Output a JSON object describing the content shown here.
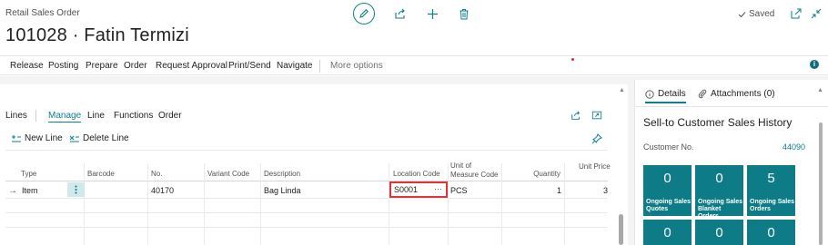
{
  "header": {
    "breadcrumb": "Retail Sales Order",
    "title": "101028 · Fatin Termizi",
    "saved_label": "Saved"
  },
  "actions": [
    "Release",
    "Posting",
    "Prepare",
    "Order",
    "Request Approval",
    "Print/Send",
    "Navigate"
  ],
  "more_options": "More options",
  "lines": {
    "title": "Lines",
    "tabs": [
      "Manage",
      "Line",
      "Functions",
      "Order"
    ],
    "new_line": "New Line",
    "delete_line": "Delete Line",
    "columns": {
      "type": "Type",
      "barcode": "Barcode",
      "no": "No.",
      "variant_code": "Variant Code",
      "description": "Description",
      "location_code": "Location Code",
      "uom_line1": "Unit of",
      "uom_line2": "Measure Code",
      "quantity": "Quantity",
      "unit_price": "Unit Price"
    },
    "row": {
      "type": "Item",
      "barcode": "",
      "no": "40170",
      "variant_code": "",
      "description": "Bag Linda",
      "location_code": "S0001",
      "uom": "PCS",
      "quantity": "1",
      "unit_price": "3"
    }
  },
  "factbox": {
    "tab_details": "Details",
    "tab_attachments": "Attachments (0)",
    "title": "Sell-to Customer Sales History",
    "customer_label": "Customer No.",
    "customer_value": "44090",
    "tiles": [
      {
        "value": "0",
        "label_1": "Ongoing Sales",
        "label_2": "Quotes"
      },
      {
        "value": "0",
        "label_1": "Ongoing Sales",
        "label_2": "Blanket Orders"
      },
      {
        "value": "5",
        "label_1": "Ongoing Sales",
        "label_2": "Orders"
      },
      {
        "value": "0"
      },
      {
        "value": "0"
      },
      {
        "value": "0"
      }
    ]
  },
  "colors": {
    "accent": "#0e7f8c",
    "tile": "#0e7c86",
    "highlight_border": "#d9373b"
  }
}
